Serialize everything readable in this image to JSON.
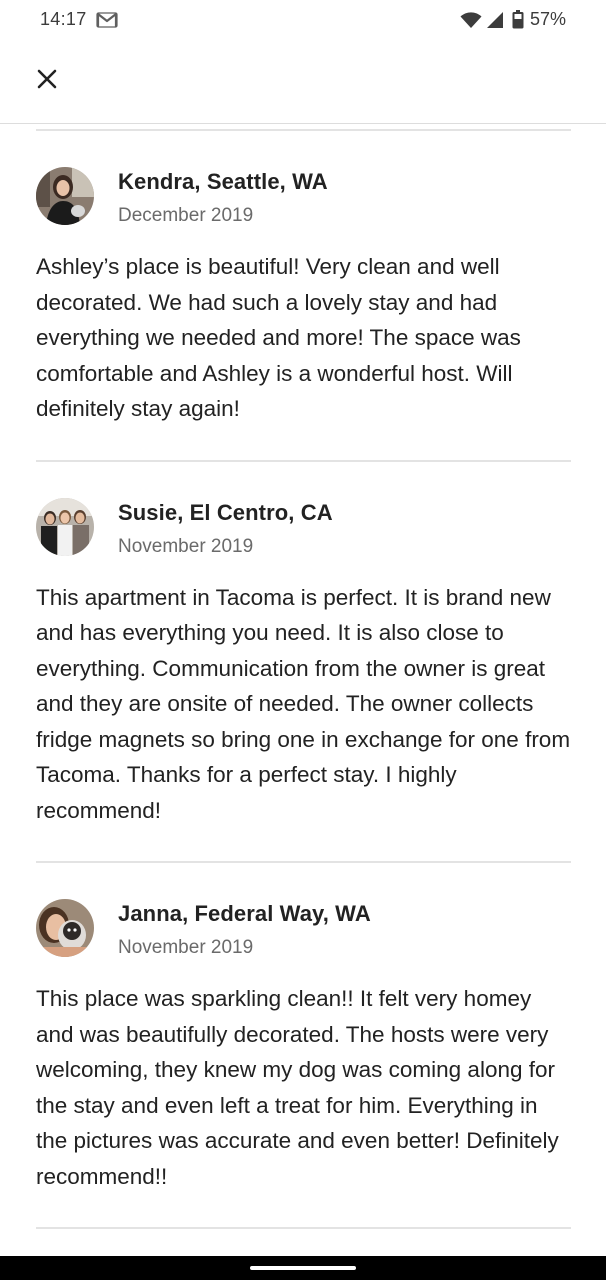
{
  "status_bar": {
    "time": "14:17",
    "battery": "57%",
    "icons": [
      "gmail-icon",
      "wifi-icon",
      "cell-signal-icon",
      "battery-icon"
    ]
  },
  "top_bar": {
    "close_icon": "close-icon"
  },
  "reviews": [
    {
      "name": "Kendra, Seattle, WA",
      "date": "December 2019",
      "text": "Ashley’s place is beautiful! Very clean and well decorated. We had such a lovely stay and had everything we needed and more! The space was comfortable and Ashley is a wonderful host. Will definitely stay again!"
    },
    {
      "name": "Susie, El Centro, CA",
      "date": "November 2019",
      "text": "This apartment in Tacoma is perfect.  It is brand new and has everything you need.  It is also close to everything.  Communication from the owner is great and they are onsite of needed.  The owner collects fridge magnets so bring one in exchange for one from Tacoma.  Thanks for a perfect stay.  I highly recommend!"
    },
    {
      "name": "Janna, Federal Way, WA",
      "date": "November 2019",
      "text": "This place was sparkling clean!! It felt very homey and was beautifully decorated. The hosts were very welcoming, they knew my dog was coming along for the stay and even left a treat for him. Everything in the pictures was accurate and even better! Definitely recommend!!"
    }
  ],
  "colors": {
    "text_primary": "#222222",
    "text_secondary": "#6a6a6a",
    "divider": "#e3e3e3"
  }
}
